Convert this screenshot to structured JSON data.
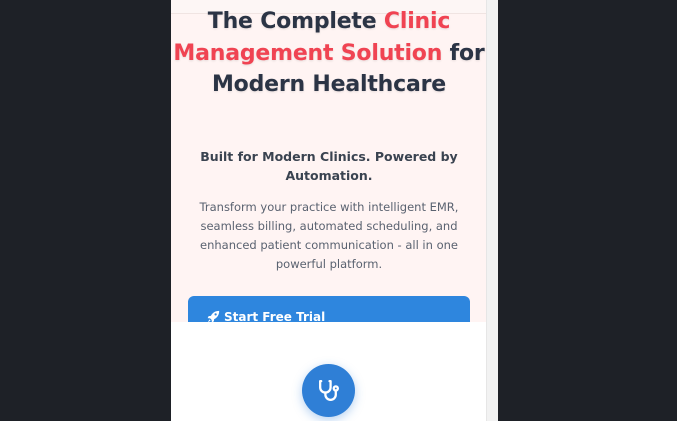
{
  "hero": {
    "headline": {
      "part1": "The Complete ",
      "accent1": "Clinic Management Solution",
      "part2": " for Modern Healthcare"
    },
    "subheading": "Built for Modern Clinics. Powered by Automation.",
    "description": "Transform your practice with intelligent EMR, seamless billing, automated scheduling, and enhanced patient communication - all in one powerful platform.",
    "cta": {
      "label": "Start Free Trial",
      "icon": "rocket-icon"
    }
  },
  "loader": {
    "icon": "stethoscope-icon"
  },
  "colors": {
    "accent": "#f04352",
    "primary": "#2e86de",
    "heading": "#2b3445",
    "hero_background": "#fff4f3",
    "page_background": "#1e2127"
  }
}
